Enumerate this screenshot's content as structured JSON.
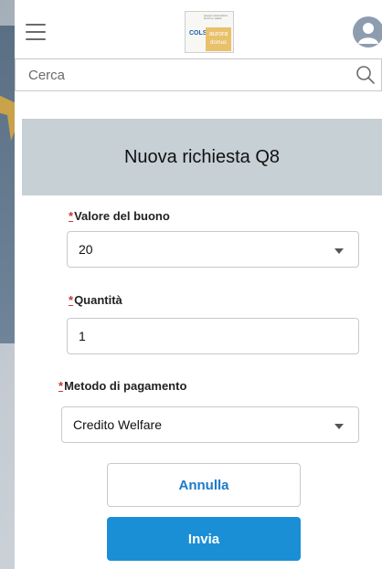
{
  "header": {
    "logo": {
      "top_text": "gruppo assicurativo servizi e salute",
      "colser": "COLSER",
      "aurora": "aurora",
      "domus": "domus"
    },
    "search_placeholder": "Cerca"
  },
  "modal": {
    "title": "Nuova richiesta Q8",
    "required_mark": "*",
    "fields": {
      "voucher_value": {
        "label": "Valore del buono",
        "value": "20"
      },
      "quantity": {
        "label": "Quantità",
        "value": "1"
      },
      "payment_method": {
        "label": "Metodo di pagamento",
        "value": "Credito Welfare"
      }
    },
    "buttons": {
      "cancel": "Annulla",
      "send": "Invia"
    }
  },
  "colors": {
    "accent": "#1a8fd6",
    "required": "#c23934",
    "modal_header_bg": "#c6d0d5"
  },
  "icons": [
    "hamburger-menu-icon",
    "user-avatar-icon",
    "search-icon",
    "dropdown-caret-icon"
  ]
}
